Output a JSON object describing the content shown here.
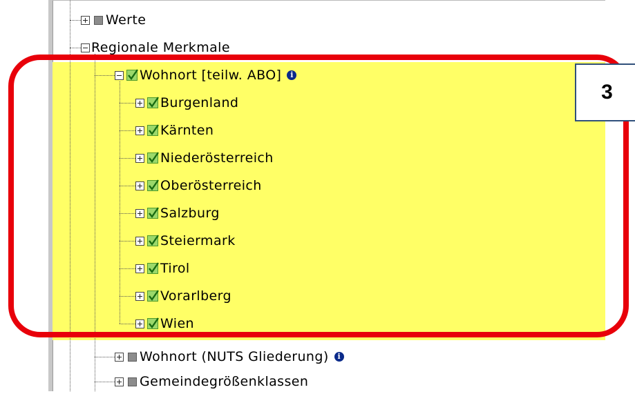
{
  "tree": {
    "werte": {
      "label": "Werte"
    },
    "regionale": {
      "label": "Regionale Merkmale"
    },
    "wohnort": {
      "label": "Wohnort [teilw. ABO]",
      "info_icon": "info-icon"
    },
    "states": [
      {
        "label": "Burgenland"
      },
      {
        "label": "Kärnten"
      },
      {
        "label": "Niederösterreich"
      },
      {
        "label": "Oberösterreich"
      },
      {
        "label": "Salzburg"
      },
      {
        "label": "Steiermark"
      },
      {
        "label": "Tirol"
      },
      {
        "label": "Vorarlberg"
      },
      {
        "label": "Wien"
      }
    ],
    "nuts": {
      "label": "Wohnort (NUTS Gliederung)",
      "info_icon": "info-icon"
    },
    "gemeinde": {
      "label": "Gemeindegrößenklassen"
    }
  },
  "callout": {
    "number": "3"
  },
  "colors": {
    "highlight": "#ffff66",
    "callout_border": "#e8000a",
    "checkbox_green": "#9bd86a"
  }
}
